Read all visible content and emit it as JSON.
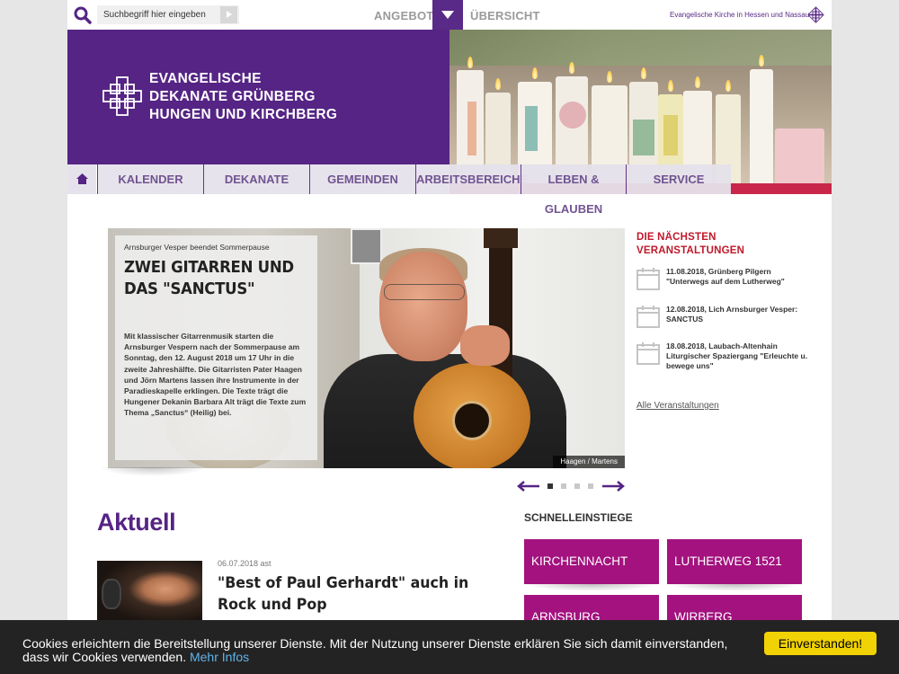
{
  "topbar": {
    "search_placeholder": "Suchbegriff hier eingeben",
    "angebote_label": "ANGEBOTE",
    "uebersicht_label": "ÜBERSICHT",
    "ekhn_label": "Evangelische Kirche in Hessen und Nassau"
  },
  "brand": {
    "line1": "EVANGELISCHE",
    "line2": "DEKANATE GRÜNBERG",
    "line3": "HUNGEN UND KIRCHBERG",
    "color": "#552484"
  },
  "nav": {
    "items": [
      {
        "label": "KALENDER"
      },
      {
        "label": "DEKANATE"
      },
      {
        "label": "GEMEINDEN"
      },
      {
        "label": "ARBEITSBEREICHE"
      },
      {
        "label": "LEBEN & GLAUBEN"
      },
      {
        "label": "SERVICE"
      }
    ]
  },
  "slider": {
    "kicker": "Arnsburger Vesper beendet Sommerpause",
    "title": "ZWEI GITARREN UND DAS \"SANCTUS\"",
    "text": "Mit klassischer Gitarrenmusik starten die Arnsburger Vespern nach der Sommerpause am Sonntag, den 12. August 2018 um 17 Uhr in die zweite Jahreshälfte. Die Gitarristen Pater Haagen und Jörn Martens lassen ihre Instrumente in der Paradieskapelle erklingen. Die Texte trägt die Hungener Dekanin Barbara Alt trägt die Texte zum Thema „Sanctus“ (Heilig) bei.",
    "credit": "Haagen / Martens",
    "dot_count": 4,
    "active_dot": 0
  },
  "events": {
    "heading_line1": "DIE NÄCHSTEN",
    "heading_line2": "VERANSTALTUNGEN",
    "items": [
      {
        "text": "11.08.2018, Grünberg Pilgern \"Unterwegs auf dem Lutherweg\""
      },
      {
        "text": "12.08.2018, Lich Arnsburger Vesper: SANCTUS"
      },
      {
        "text": "18.08.2018, Laubach-Altenhain Liturgischer Spaziergang \"Erleuchte u. bewege uns\""
      }
    ],
    "all_label": "Alle Veranstaltungen",
    "accent": "#c0182a"
  },
  "aktuell": {
    "heading": "Aktuell",
    "news_date": "06.07.2018 ast",
    "news_title": "\"Best of Paul Gerhardt\" auch in Rock und Pop"
  },
  "quick": {
    "heading": "SCHNELLEINSTIEGE",
    "tiles": [
      {
        "label": "KIRCHENNACHT"
      },
      {
        "label": "LUTHERWEG 1521"
      },
      {
        "label": "ARNSBURG"
      },
      {
        "label": "WIRBERG"
      }
    ],
    "color": "#a3127e"
  },
  "cookie": {
    "text_line1": "Cookies erleichtern die Bereitstellung unserer Dienste. Mit der Nutzung unserer Dienste erklären Sie sich damit einverstanden,",
    "text_line2": "dass wir Cookies verwenden.",
    "more_label": "Mehr Infos",
    "accept_label": "Einverstanden!",
    "button_color": "#f1d204"
  }
}
